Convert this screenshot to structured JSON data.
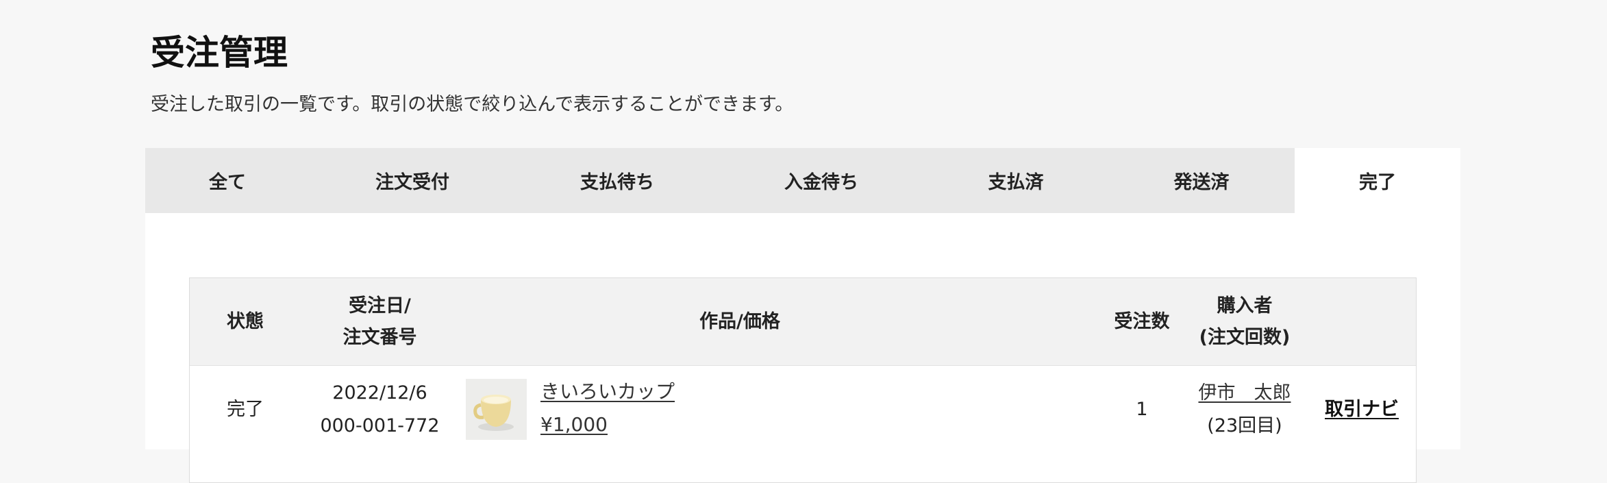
{
  "header": {
    "title": "受注管理",
    "description": "受注した取引の一覧です。取引の状態で絞り込んで表示することができます。"
  },
  "tabs": [
    {
      "label": "全て",
      "active": false
    },
    {
      "label": "注文受付",
      "active": false
    },
    {
      "label": "支払待ち",
      "active": false
    },
    {
      "label": "入金待ち",
      "active": false
    },
    {
      "label": "支払済",
      "active": false
    },
    {
      "label": "発送済",
      "active": false
    },
    {
      "label": "完了",
      "active": true
    }
  ],
  "table": {
    "headers": {
      "status": "状態",
      "date_line1": "受注日/",
      "date_line2": "注文番号",
      "product": "作品/価格",
      "quantity": "受注数",
      "buyer_line1": "購入者",
      "buyer_line2": "(注文回数)"
    },
    "rows": [
      {
        "status": "完了",
        "date": "2022/12/6",
        "order_number": "000-001-772",
        "product_name": "きいろいカップ ",
        "price": "¥1,000",
        "quantity": "1",
        "buyer_name": "伊市　太郎",
        "order_count": "(23回目)",
        "action": "取引ナビ"
      }
    ]
  },
  "colors": {
    "page_bg": "#f7f7f7",
    "tab_bg": "#e8e8e8",
    "active_tab_bg": "#ffffff",
    "table_header_bg": "#f2f2f2",
    "cup": "#ecd99a"
  },
  "icons": {
    "product_thumbnail": "yellow-cup-image"
  }
}
